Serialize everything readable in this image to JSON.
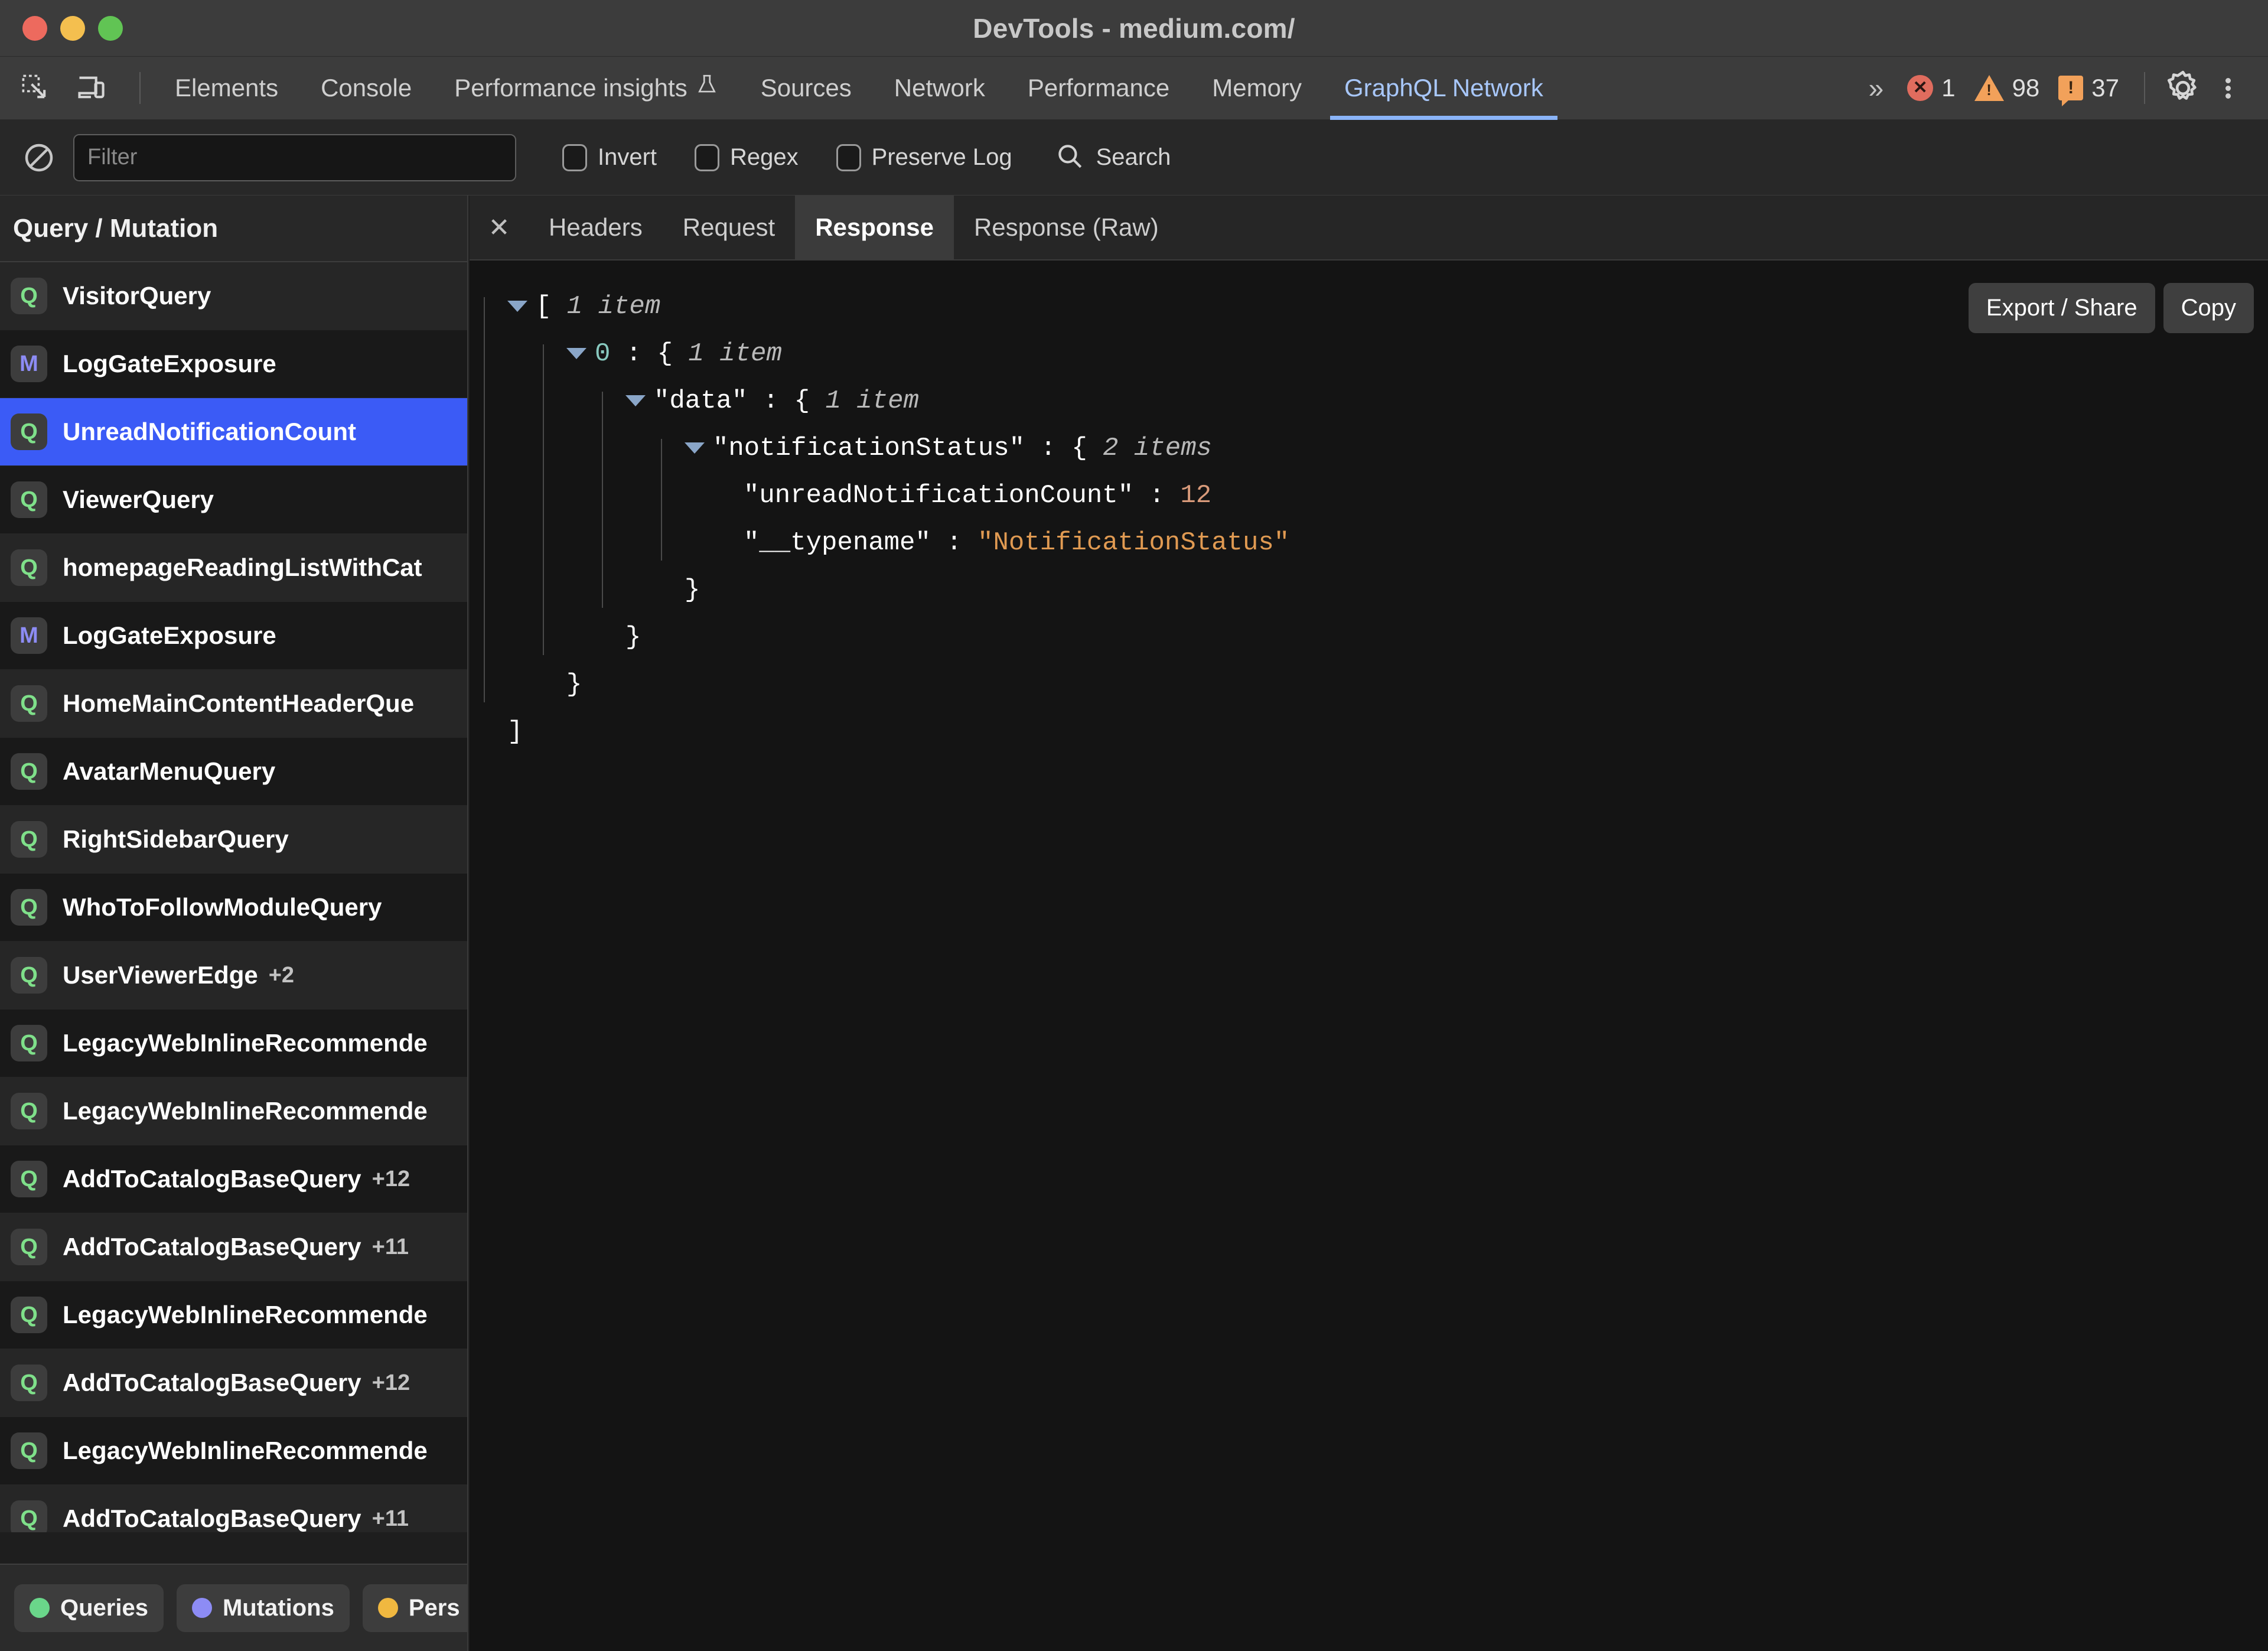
{
  "window": {
    "title": "DevTools - medium.com/",
    "traffic_lights": [
      "close",
      "minimize",
      "maximize"
    ]
  },
  "toolbar": {
    "icons": [
      {
        "name": "inspect-element-icon"
      },
      {
        "name": "device-toolbar-icon"
      }
    ],
    "tabs": [
      {
        "label": "Elements",
        "active": false
      },
      {
        "label": "Console",
        "active": false
      },
      {
        "label": "Performance insights",
        "active": false,
        "flask": "⚗"
      },
      {
        "label": "Sources",
        "active": false
      },
      {
        "label": "Network",
        "active": false
      },
      {
        "label": "Performance",
        "active": false
      },
      {
        "label": "Memory",
        "active": false
      },
      {
        "label": "GraphQL Network",
        "active": true
      }
    ],
    "overflow_label": "»",
    "counters": {
      "errors": "1",
      "warnings": "98",
      "infos": "37"
    },
    "settings_label": "gear-icon",
    "more_label": "kebab-icon",
    "active_tab_color": "#a8c7fa",
    "error_color": "#e06c5e",
    "warning_color": "#f2a15a"
  },
  "filterbar": {
    "clear_icon": "clear-icon",
    "filter": {
      "value": "",
      "placeholder": "Filter"
    },
    "checkboxes": [
      {
        "label": "Invert",
        "checked": false
      },
      {
        "label": "Regex",
        "checked": false
      },
      {
        "label": "Preserve Log",
        "checked": false
      }
    ],
    "search_label": "Search"
  },
  "sidebar": {
    "header": "Query / Mutation",
    "items": [
      {
        "kind": "Q",
        "name": "VisitorQuery",
        "extra": "",
        "selected": false
      },
      {
        "kind": "M",
        "name": "LogGateExposure",
        "extra": "",
        "selected": false
      },
      {
        "kind": "Q",
        "name": "UnreadNotificationCount",
        "extra": "",
        "selected": true
      },
      {
        "kind": "Q",
        "name": "ViewerQuery",
        "extra": "",
        "selected": false
      },
      {
        "kind": "Q",
        "name": "homepageReadingListWithCat",
        "extra": "",
        "selected": false
      },
      {
        "kind": "M",
        "name": "LogGateExposure",
        "extra": "",
        "selected": false
      },
      {
        "kind": "Q",
        "name": "HomeMainContentHeaderQue",
        "extra": "",
        "selected": false
      },
      {
        "kind": "Q",
        "name": "AvatarMenuQuery",
        "extra": "",
        "selected": false
      },
      {
        "kind": "Q",
        "name": "RightSidebarQuery",
        "extra": "",
        "selected": false
      },
      {
        "kind": "Q",
        "name": "WhoToFollowModuleQuery",
        "extra": "",
        "selected": false
      },
      {
        "kind": "Q",
        "name": "UserViewerEdge",
        "extra": "+2",
        "selected": false
      },
      {
        "kind": "Q",
        "name": "LegacyWebInlineRecommende",
        "extra": "",
        "selected": false
      },
      {
        "kind": "Q",
        "name": "LegacyWebInlineRecommende",
        "extra": "",
        "selected": false
      },
      {
        "kind": "Q",
        "name": "AddToCatalogBaseQuery",
        "extra": "+12",
        "selected": false
      },
      {
        "kind": "Q",
        "name": "AddToCatalogBaseQuery",
        "extra": "+11",
        "selected": false
      },
      {
        "kind": "Q",
        "name": "LegacyWebInlineRecommende",
        "extra": "",
        "selected": false
      },
      {
        "kind": "Q",
        "name": "AddToCatalogBaseQuery",
        "extra": "+12",
        "selected": false
      },
      {
        "kind": "Q",
        "name": "LegacyWebInlineRecommende",
        "extra": "",
        "selected": false
      },
      {
        "kind": "Q",
        "name": "AddToCatalogBaseQuery",
        "extra": "+11",
        "selected": false
      }
    ],
    "legend": [
      {
        "label": "Queries",
        "color": "#6ad68a"
      },
      {
        "label": "Mutations",
        "color": "#8d8cf5"
      },
      {
        "label": "Pers",
        "color": "#f0b840"
      }
    ]
  },
  "detail": {
    "close_label": "✕",
    "tabs": [
      {
        "label": "Headers",
        "active": false
      },
      {
        "label": "Request",
        "active": false
      },
      {
        "label": "Response",
        "active": true
      },
      {
        "label": "Response (Raw)",
        "active": false
      }
    ],
    "actions": {
      "export_label": "Export / Share",
      "copy_label": "Copy"
    },
    "tree": [
      {
        "indent": 0,
        "caret": true,
        "key": "",
        "keytype": "none",
        "punct": "[",
        "meta": "1 item",
        "value": "",
        "valtype": ""
      },
      {
        "indent": 1,
        "caret": true,
        "key": "0",
        "keytype": "num",
        "punct": "{",
        "meta": "1 item",
        "value": "",
        "valtype": ""
      },
      {
        "indent": 2,
        "caret": true,
        "key": "\"data\"",
        "keytype": "str",
        "punct": "{",
        "meta": "1 item",
        "value": "",
        "valtype": ""
      },
      {
        "indent": 3,
        "caret": true,
        "key": "\"notificationStatus\"",
        "keytype": "str",
        "punct": "{",
        "meta": "2 items",
        "value": "",
        "valtype": ""
      },
      {
        "indent": 4,
        "caret": false,
        "key": "\"unreadNotificationCount\"",
        "keytype": "str",
        "punct": "",
        "meta": "",
        "value": "12",
        "valtype": "num"
      },
      {
        "indent": 4,
        "caret": false,
        "key": "\"__typename\"",
        "keytype": "str",
        "punct": "",
        "meta": "",
        "value": "\"NotificationStatus\"",
        "valtype": "str"
      },
      {
        "indent": 3,
        "caret": false,
        "key": "",
        "keytype": "none",
        "punct": "}",
        "meta": "",
        "value": "",
        "valtype": ""
      },
      {
        "indent": 2,
        "caret": false,
        "key": "",
        "keytype": "none",
        "punct": "}",
        "meta": "",
        "value": "",
        "valtype": ""
      },
      {
        "indent": 1,
        "caret": false,
        "key": "",
        "keytype": "none",
        "punct": "}",
        "meta": "",
        "value": "",
        "valtype": ""
      },
      {
        "indent": 0,
        "caret": false,
        "key": "",
        "keytype": "none",
        "punct": "]",
        "meta": "",
        "value": "",
        "valtype": ""
      }
    ]
  }
}
